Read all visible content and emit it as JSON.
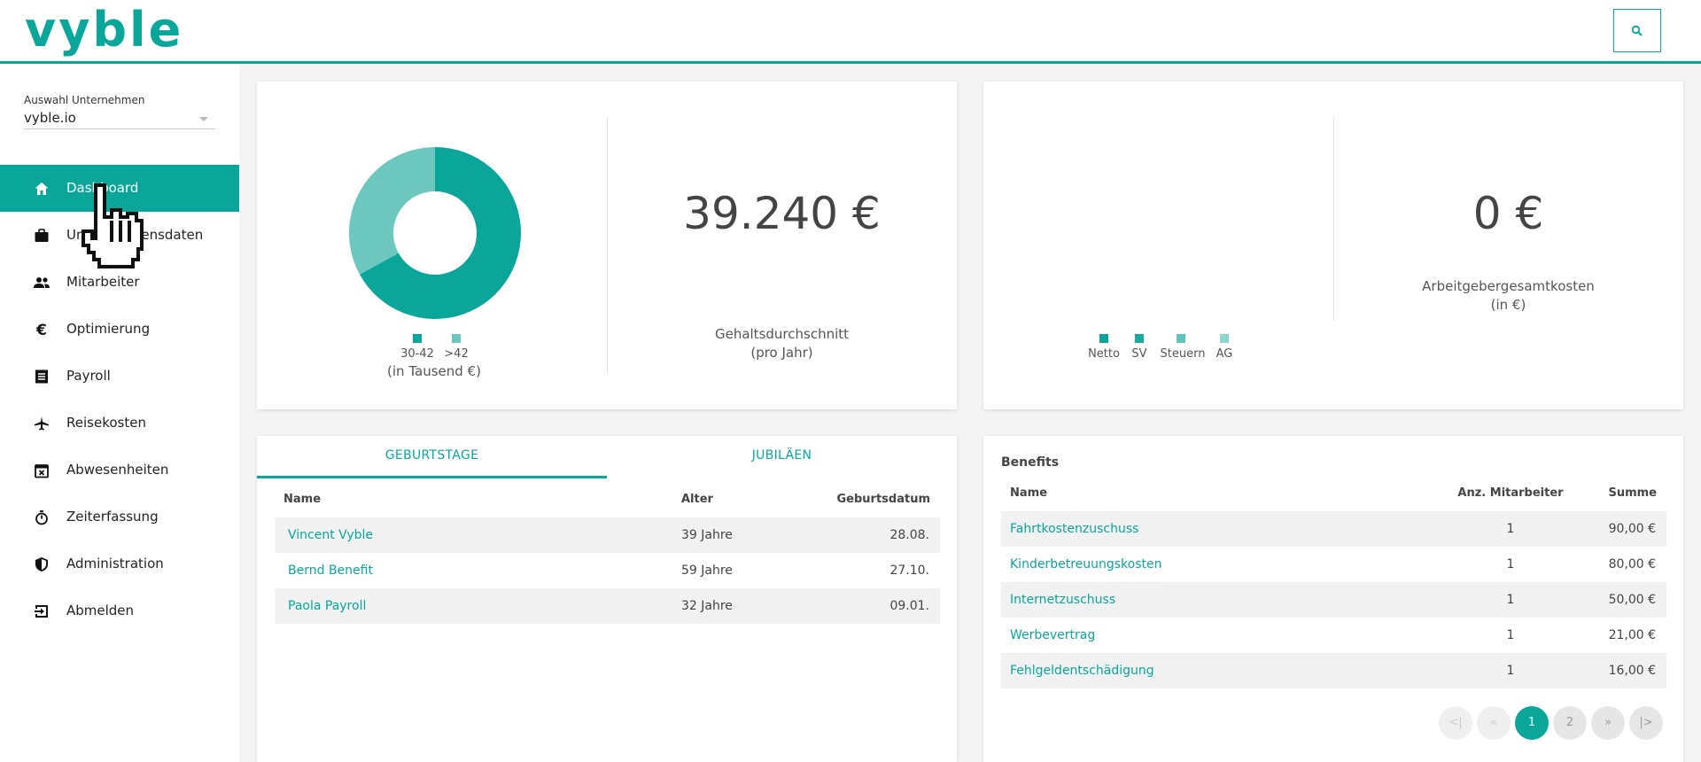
{
  "app": {
    "logo": "vyble"
  },
  "header": {
    "search_icon": "search-icon"
  },
  "sidebar": {
    "company_label": "Auswahl Unternehmen",
    "company_value": "vyble.io",
    "items": [
      {
        "label": "Dashboard",
        "icon": "home-icon",
        "active": true
      },
      {
        "label": "Unternehmensdaten",
        "icon": "briefcase-icon"
      },
      {
        "label": "Mitarbeiter",
        "icon": "people-icon"
      },
      {
        "label": "Optimierung",
        "icon": "euro-icon"
      },
      {
        "label": "Payroll",
        "icon": "list-icon"
      },
      {
        "label": "Reisekosten",
        "icon": "airplane-icon"
      },
      {
        "label": "Abwesenheiten",
        "icon": "calendar-x-icon"
      },
      {
        "label": "Zeiterfassung",
        "icon": "stopwatch-icon"
      },
      {
        "label": "Administration",
        "icon": "shield-icon"
      },
      {
        "label": "Abmelden",
        "icon": "logout-icon"
      }
    ]
  },
  "salary_card": {
    "legend": [
      "30-42",
      ">42"
    ],
    "legend_unit": "(in Tausend €)",
    "value": "39.240 €",
    "label_line1": "Gehaltsdurchschnitt",
    "label_line2": "(pro Jahr)",
    "colors": {
      "primary": "#0aa69a",
      "secondary": "#6cc8be"
    }
  },
  "chart_data": {
    "type": "pie",
    "categories": [
      "30-42",
      ">42"
    ],
    "values": [
      67,
      33
    ],
    "donut": true
  },
  "cost_card": {
    "legend": [
      "Netto",
      "SV",
      "Steuern",
      "AG"
    ],
    "legend_colors": [
      "#0aa69a",
      "#17ab9f",
      "#5cc4ba",
      "#8ad6ce"
    ],
    "value": "0 €",
    "label_line1": "Arbeitgebergesamtkosten",
    "label_line2": "(in €)"
  },
  "events": {
    "tabs": [
      "GEBURTSTAGE",
      "JUBILÄEN"
    ],
    "headers": {
      "name": "Name",
      "age": "Alter",
      "date": "Geburtsdatum"
    },
    "rows": [
      {
        "name": "Vincent Vyble",
        "age": "39 Jahre",
        "date": "28.08."
      },
      {
        "name": "Bernd Benefit",
        "age": "59 Jahre",
        "date": "27.10."
      },
      {
        "name": "Paola Payroll",
        "age": "32 Jahre",
        "date": "09.01."
      }
    ]
  },
  "benefits": {
    "title": "Benefits",
    "headers": {
      "name": "Name",
      "count": "Anz. Mitarbeiter",
      "sum": "Summe"
    },
    "rows": [
      {
        "name": "Fahrtkostenzuschuss",
        "count": "1",
        "sum": "90,00 €"
      },
      {
        "name": "Kinderbetreuungskosten",
        "count": "1",
        "sum": "80,00 €"
      },
      {
        "name": "Internetzuschuss",
        "count": "1",
        "sum": "50,00 €"
      },
      {
        "name": "Werbevertrag",
        "count": "1",
        "sum": "21,00 €"
      },
      {
        "name": "Fehlgeldentschädigung",
        "count": "1",
        "sum": "16,00 €"
      }
    ],
    "pager": [
      "<|",
      "«",
      "1",
      "2",
      "»",
      "|>"
    ],
    "current_page": "1"
  }
}
